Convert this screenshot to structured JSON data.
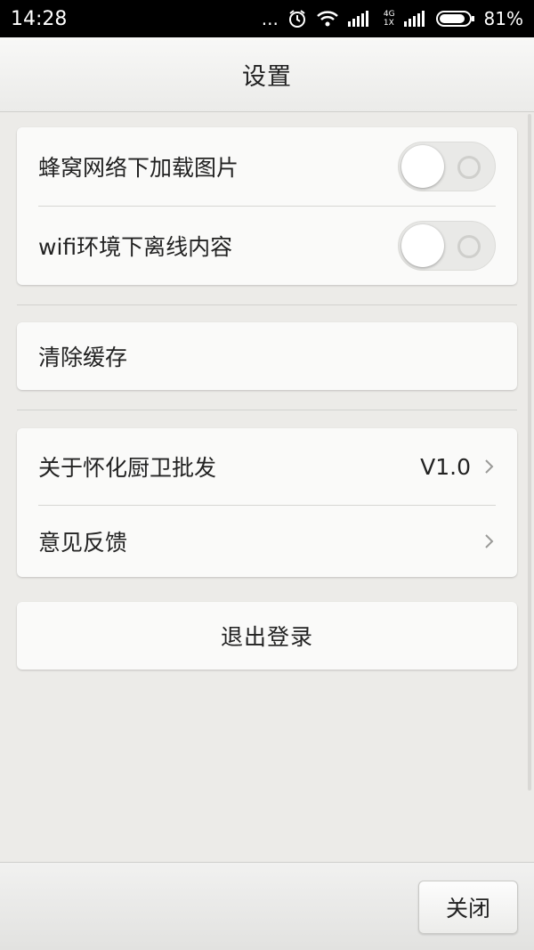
{
  "status_bar": {
    "time": "14:28",
    "dots": "...",
    "net_tags": [
      "4G",
      "1X"
    ],
    "battery": "81%",
    "icons": [
      "alarm-icon",
      "wifi-icon",
      "signal-icon",
      "battery-icon"
    ]
  },
  "header": {
    "title": "设置"
  },
  "toggles": [
    {
      "label": "蜂窝网络下加载图片",
      "state": "off"
    },
    {
      "label": "wifi环境下离线内容",
      "state": "off"
    }
  ],
  "cache": {
    "label": "清除缓存"
  },
  "about": {
    "label": "关于怀化厨卫批发",
    "version": "V1.0"
  },
  "feedback": {
    "label": "意见反馈"
  },
  "logout": {
    "label": "退出登录"
  },
  "footer": {
    "close_label": "关闭"
  },
  "colors": {
    "background": "#ecebe8",
    "card": "#fafaf9",
    "text": "#222222"
  }
}
